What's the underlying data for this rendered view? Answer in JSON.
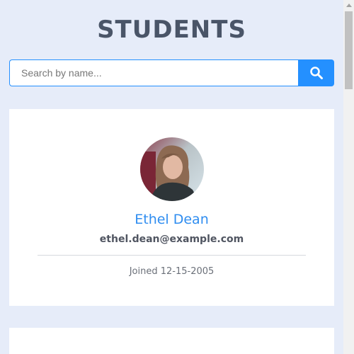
{
  "page": {
    "title": "STUDENTS"
  },
  "search": {
    "placeholder": "Search by name...",
    "value": "",
    "button_icon": "search-icon",
    "accent_color": "#2490ff"
  },
  "students": [
    {
      "name": "Ethel Dean",
      "email": "ethel.dean@example.com",
      "joined": "Joined 12-15-2005"
    }
  ],
  "colors": {
    "background": "#e6ecf9",
    "name": "#2f8df0",
    "title": "#4a5568"
  }
}
